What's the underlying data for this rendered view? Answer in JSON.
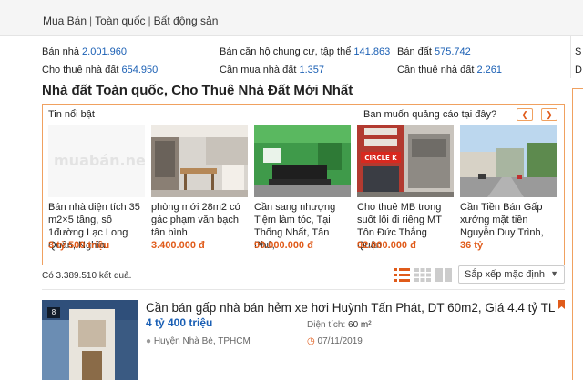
{
  "breadcrumb": [
    "Mua Bán",
    "Toàn quốc",
    "Bất động sản"
  ],
  "categories": [
    {
      "label": "Bán nhà",
      "count": "2.001.960"
    },
    {
      "label": "Bán căn hộ chung cư, tập thể",
      "count": "141.863"
    },
    {
      "label": "Bán đất",
      "count": "575.742"
    },
    {
      "label": "Cho thuê nhà đất",
      "count": "654.950"
    },
    {
      "label": "Cần mua nhà đất",
      "count": "1.357"
    },
    {
      "label": "Cần thuê nhà đất",
      "count": "2.261"
    }
  ],
  "right_edge": [
    "S",
    "D"
  ],
  "page_title": "Nhà đất Toàn quốc, Cho Thuê Nhà Đất Mới Nhất",
  "featured": {
    "heading": "Tin nổi bật",
    "ad_prompt": "Bạn muốn quảng cáo tại đây?",
    "prev_icon": "chevron-left-icon",
    "next_icon": "chevron-right-icon",
    "cards": [
      {
        "title": "Bán nhà diện tích 35 m2×5 tầng, số 1đường Lạc Long Quân, Nghĩa",
        "price": "3 tỷ 500 triệu",
        "placeholder": "muabán.net"
      },
      {
        "title": "phòng mới 28m2 có gác phạm văn bạch tân bình",
        "price": "3.400.000 đ"
      },
      {
        "title": "Cần sang nhượng Tiệm làm tóc, Tại Thống Nhất, Tân Phú,",
        "price": "90.000.000 đ"
      },
      {
        "title": "Cho thuê MB trong suốt lối đi riêng MT Tôn Đức Thắng Quận",
        "price": "92.000.000 đ"
      },
      {
        "title": "Cần Tiền Bán Gấp xưởng mặt tiền Nguyễn Duy Trình,",
        "price": "36 tỷ"
      }
    ]
  },
  "results": {
    "count_text": "Có 3.389.510 kết quả."
  },
  "sort": {
    "label": "Sắp xếp mặc định"
  },
  "listing": {
    "photo_count": "8",
    "title": "Cần bán gấp nhà bán hẻm xe hơi Huỳnh Tấn Phát, DT 60m2, Giá 4.4 tỷ TL",
    "price": "4 tỷ 400 triệu",
    "area_label": "Diện tích:",
    "area_value": "60 m²",
    "location": "Huyện Nhà Bè, TPHCM",
    "date": "07/11/2019"
  },
  "colors": {
    "accent": "#e05b1a",
    "link": "#1a5fb4",
    "border": "#f0a160"
  }
}
